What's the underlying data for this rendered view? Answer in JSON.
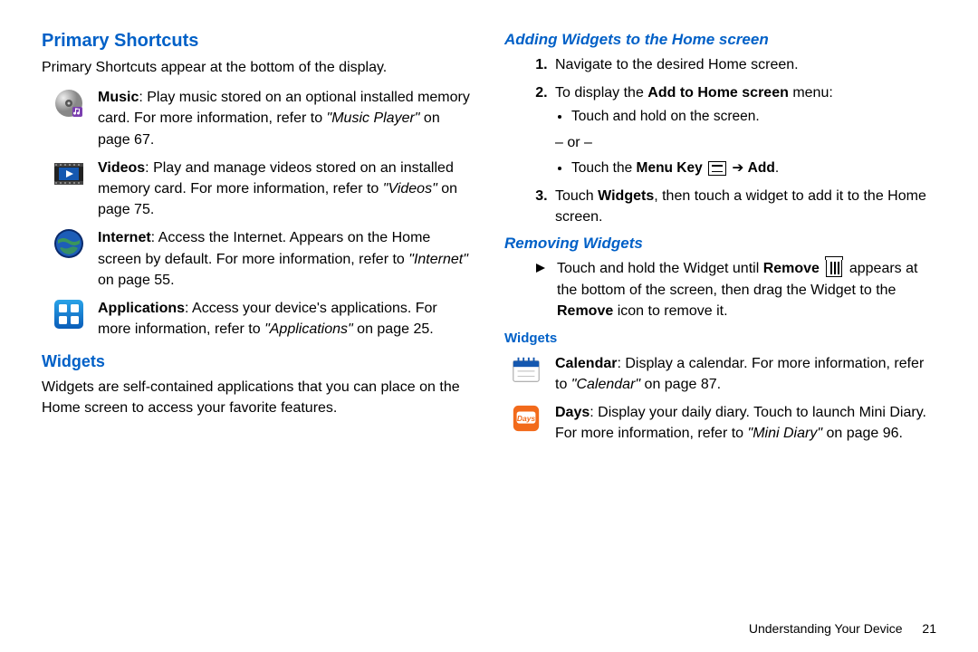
{
  "left": {
    "h1": "Primary Shortcuts",
    "intro": "Primary Shortcuts appear at the bottom of the display.",
    "items": [
      {
        "bold": "Music",
        "text": ": Play music stored on an optional installed memory card. For more information, refer to ",
        "ref": "\"Music Player\"",
        "tail": " on page 67."
      },
      {
        "bold": "Videos",
        "text": ": Play and manage videos stored on an installed memory card. For more information, refer to ",
        "ref": "\"Videos\"",
        "tail": " on page 75."
      },
      {
        "bold": "Internet",
        "text": ": Access the Internet. Appears on the Home screen by default. For more information, refer to ",
        "ref": "\"Internet\"",
        "tail": " on page 55."
      },
      {
        "bold": "Applications",
        "text": ": Access your device's applications. For more information, refer to ",
        "ref": "\"Applications\"",
        "tail": " on page 25."
      }
    ],
    "widgets_h": "Widgets",
    "widgets_p": "Widgets are self-contained applications that you can place on the Home screen to access your favorite features."
  },
  "right": {
    "adding_h": "Adding Widgets to the Home screen",
    "step1": "Navigate to the desired Home screen.",
    "step2_lead": "To display the ",
    "step2_bold": "Add to Home screen",
    "step2_tail": " menu:",
    "step2_b1": "Touch and hold on the screen.",
    "step2_or": "– or –",
    "step2_b2a": "Touch the ",
    "step2_b2b": "Menu Key",
    "step2_b2c": " ➔ ",
    "step2_b2d": "Add",
    "step3a": "Touch ",
    "step3b": "Widgets",
    "step3c": ", then touch a widget to add it to the Home screen.",
    "removing_h": "Removing Widgets",
    "remove_a": "Touch and hold the Widget until ",
    "remove_b": "Remove",
    "remove_c": " appears at the bottom of the screen, then drag the Widget to the ",
    "remove_d": "Remove",
    "remove_e": " icon to remove it.",
    "widgets_h": "Widgets",
    "w_items": [
      {
        "bold": "Calendar",
        "text": ": Display a calendar. For more information, refer to ",
        "ref": "\"Calendar\"",
        "tail": " on page 87."
      },
      {
        "bold": "Days",
        "text": ": Display your daily diary. Touch to launch Mini Diary. For more information, refer to ",
        "ref": "\"Mini Diary\"",
        "tail": " on page 96."
      }
    ]
  },
  "footer": {
    "section": "Understanding Your Device",
    "page": "21"
  }
}
